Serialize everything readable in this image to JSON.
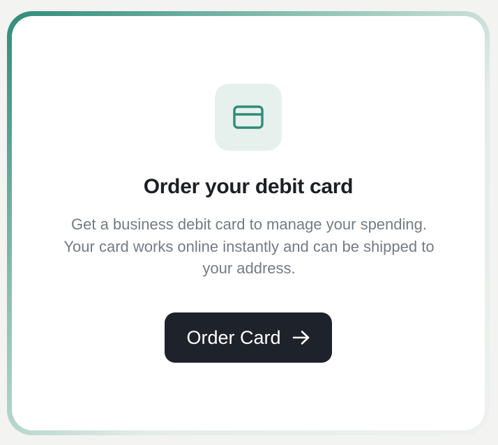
{
  "card": {
    "icon": "credit-card-icon",
    "title": "Order your debit card",
    "description": "Get a business debit card to manage your spending. Your card works online instantly and can be shipped to your address.",
    "button_label": "Order Card",
    "button_icon": "arrow-right-icon"
  },
  "colors": {
    "accent": "#2f8c78",
    "icon_tile_bg": "#e6f1ee",
    "button_bg": "#1e222b",
    "title": "#1c1f26",
    "description": "#747b86"
  }
}
